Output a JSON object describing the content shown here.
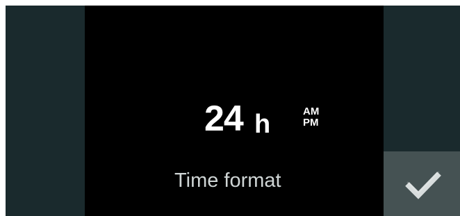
{
  "setting": {
    "value": "24",
    "unit": "h",
    "alternate_format": {
      "am": "AM",
      "pm": "PM"
    },
    "label": "Time format"
  },
  "confirm": {
    "icon": "checkmark-icon"
  },
  "colors": {
    "background": "#000000",
    "side_panels": "#1a2a2d",
    "confirm_button": "#455253",
    "value_text": "#ffffff",
    "label_text": "#cfd5d5",
    "check": "#d8dddd"
  }
}
